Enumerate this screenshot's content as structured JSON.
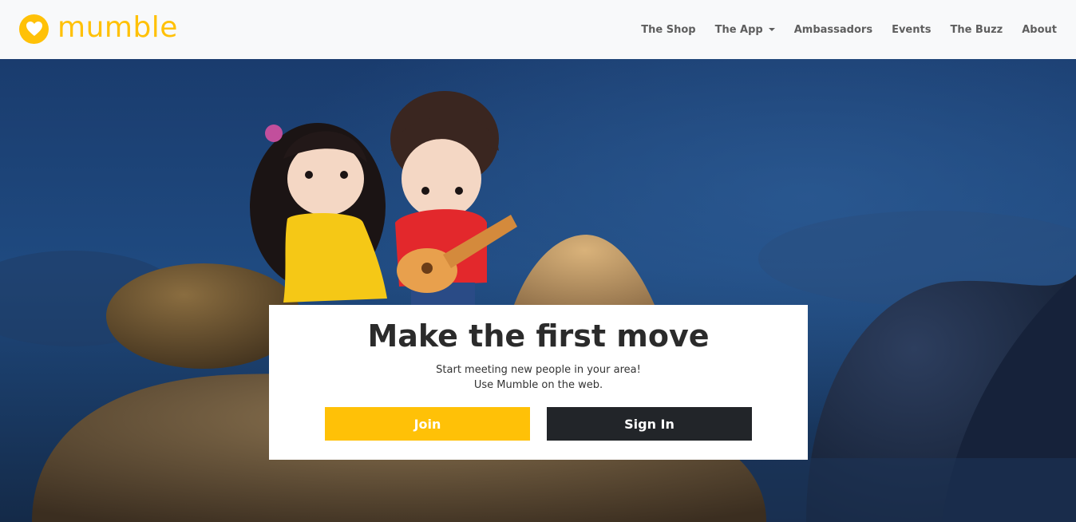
{
  "brand": {
    "name": "mumble"
  },
  "nav": {
    "items": [
      {
        "label": "The Shop"
      },
      {
        "label": "The App",
        "has_dropdown": true
      },
      {
        "label": "Ambassadors"
      },
      {
        "label": "Events"
      },
      {
        "label": "The Buzz"
      },
      {
        "label": "About"
      }
    ]
  },
  "hero": {
    "title": "Make the first move",
    "subtitle_line1": "Start meeting new people in your area!",
    "subtitle_line2": "Use Mumble on the web.",
    "join_label": "Join",
    "signin_label": "Sign In"
  },
  "colors": {
    "accent": "#ffc107",
    "dark": "#222529",
    "navbar_bg": "#f8f9fa"
  },
  "icons": {
    "logo": "heart-icon"
  }
}
